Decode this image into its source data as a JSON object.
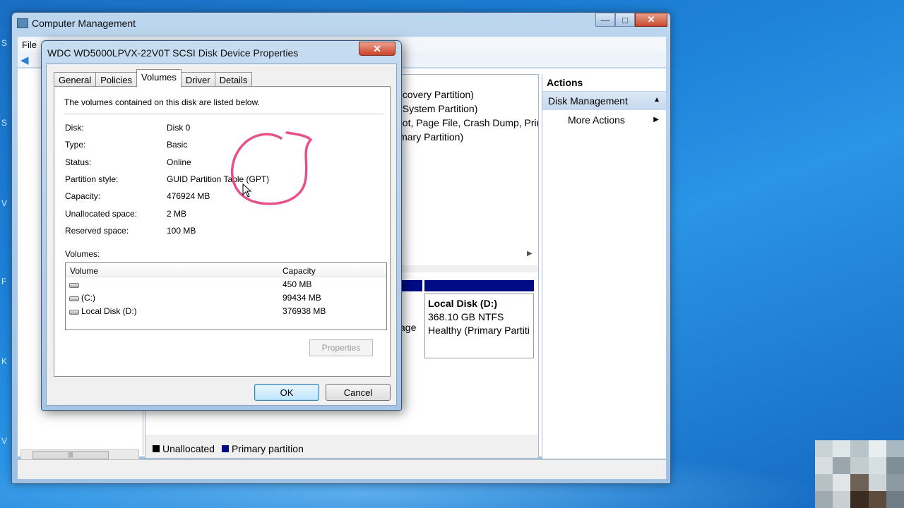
{
  "colors": {
    "accent": "#1a6fc4",
    "primary_partition": "#000b86",
    "annotation": "#e8508a"
  },
  "desktop": {
    "edge_letters": [
      "S",
      "S",
      "V",
      "F",
      "K",
      "V"
    ]
  },
  "main_window": {
    "title": "Computer Management",
    "menu_file": "File",
    "caption_icons": [
      "minimize-icon",
      "maximize-icon",
      "close-icon"
    ],
    "volume_list_fragments": [
      "ecovery Partition)",
      "I System Partition)",
      "oot, Page File, Crash Dump, Prir",
      "imary Partition)"
    ],
    "disk_d": {
      "name": "Local Disk  (D:)",
      "size": "368.10 GB NTFS",
      "status": "Healthy (Primary Partiti"
    },
    "left_fragment": "age",
    "legend": {
      "unallocated": "Unallocated",
      "primary": "Primary partition"
    },
    "actions": {
      "title": "Actions",
      "section": "Disk Management",
      "more": "More Actions"
    }
  },
  "dialog": {
    "title": "WDC WD5000LPVX-22V0T SCSI Disk Device Properties",
    "close_glyph": "✕",
    "tabs": [
      {
        "label": "General"
      },
      {
        "label": "Policies"
      },
      {
        "label": "Volumes",
        "active": true
      },
      {
        "label": "Driver"
      },
      {
        "label": "Details"
      }
    ],
    "intro": "The volumes contained on this disk are listed below.",
    "properties": [
      {
        "label": "Disk:",
        "value": "Disk 0"
      },
      {
        "label": "Type:",
        "value": "Basic"
      },
      {
        "label": "Status:",
        "value": "Online"
      },
      {
        "label": "Partition style:",
        "value": "GUID Partition Table (GPT)"
      },
      {
        "label": "Capacity:",
        "value": "476924 MB"
      },
      {
        "label": "Unallocated space:",
        "value": "2 MB"
      },
      {
        "label": "Reserved space:",
        "value": "100 MB"
      }
    ],
    "volumes_caption": "Volumes:",
    "volume_columns": {
      "volume": "Volume",
      "capacity": "Capacity"
    },
    "volumes": [
      {
        "name": "",
        "capacity": "450 MB"
      },
      {
        "name": "(C:)",
        "capacity": "99434 MB"
      },
      {
        "name": "Local Disk (D:)",
        "capacity": "376938 MB"
      }
    ],
    "properties_button": "Properties",
    "ok_button": "OK",
    "cancel_button": "Cancel"
  }
}
